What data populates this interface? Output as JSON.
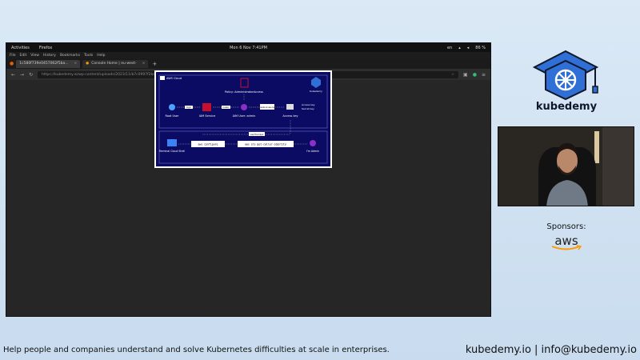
{
  "os_topbar": {
    "activities": "Activities",
    "app": "Firefox",
    "datetime": "Mon 6 Nov 7:41PM",
    "lang": "en",
    "battery": "86 %"
  },
  "browser": {
    "menu": [
      "File",
      "Edit",
      "View",
      "History",
      "Bookmarks",
      "Tools",
      "Help"
    ],
    "tabs": [
      {
        "label": "1c580f739e0457062f5ba..."
      },
      {
        "label": "Console Home | eu-west-"
      }
    ],
    "url": "https://kubedemy.io/wp-content/uploads/2023/11/b7c0997f2bc455442f0facef943c9f0be.gif"
  },
  "diagram": {
    "cloud_label": "AWS Cloud",
    "brand_small": "Kubedemy",
    "policy_label": "Policy: AdministratorAccess",
    "nodes": [
      "Root User",
      "IAM Service",
      "IAM User: admin",
      "Access key"
    ],
    "edge_labels": [
      "login",
      "create",
      "create access key"
    ],
    "key_items": [
      "Access key",
      "Secret key"
    ],
    "bottom_nodes": [
      "Terminal Cloud Shell",
      "aws configure",
      "aws sts get-caller-identity",
      "I'm Admin"
    ],
    "use_keys_label": "use the keys"
  },
  "brand": {
    "name": "kubedemy"
  },
  "sponsors": {
    "label": "Sponsors:",
    "aws": "aws"
  },
  "footer": {
    "tagline": "Help people and companies understand and solve Kubernetes difficulties at scale in enterprises.",
    "contact": "kubedemy.io | info@kubedemy.io"
  },
  "colors": {
    "diagram_bg": "#0b0b63",
    "accent_red": "#c8102e",
    "accent_purple": "#8b2fc9",
    "brand_blue": "#2f6fd6"
  }
}
